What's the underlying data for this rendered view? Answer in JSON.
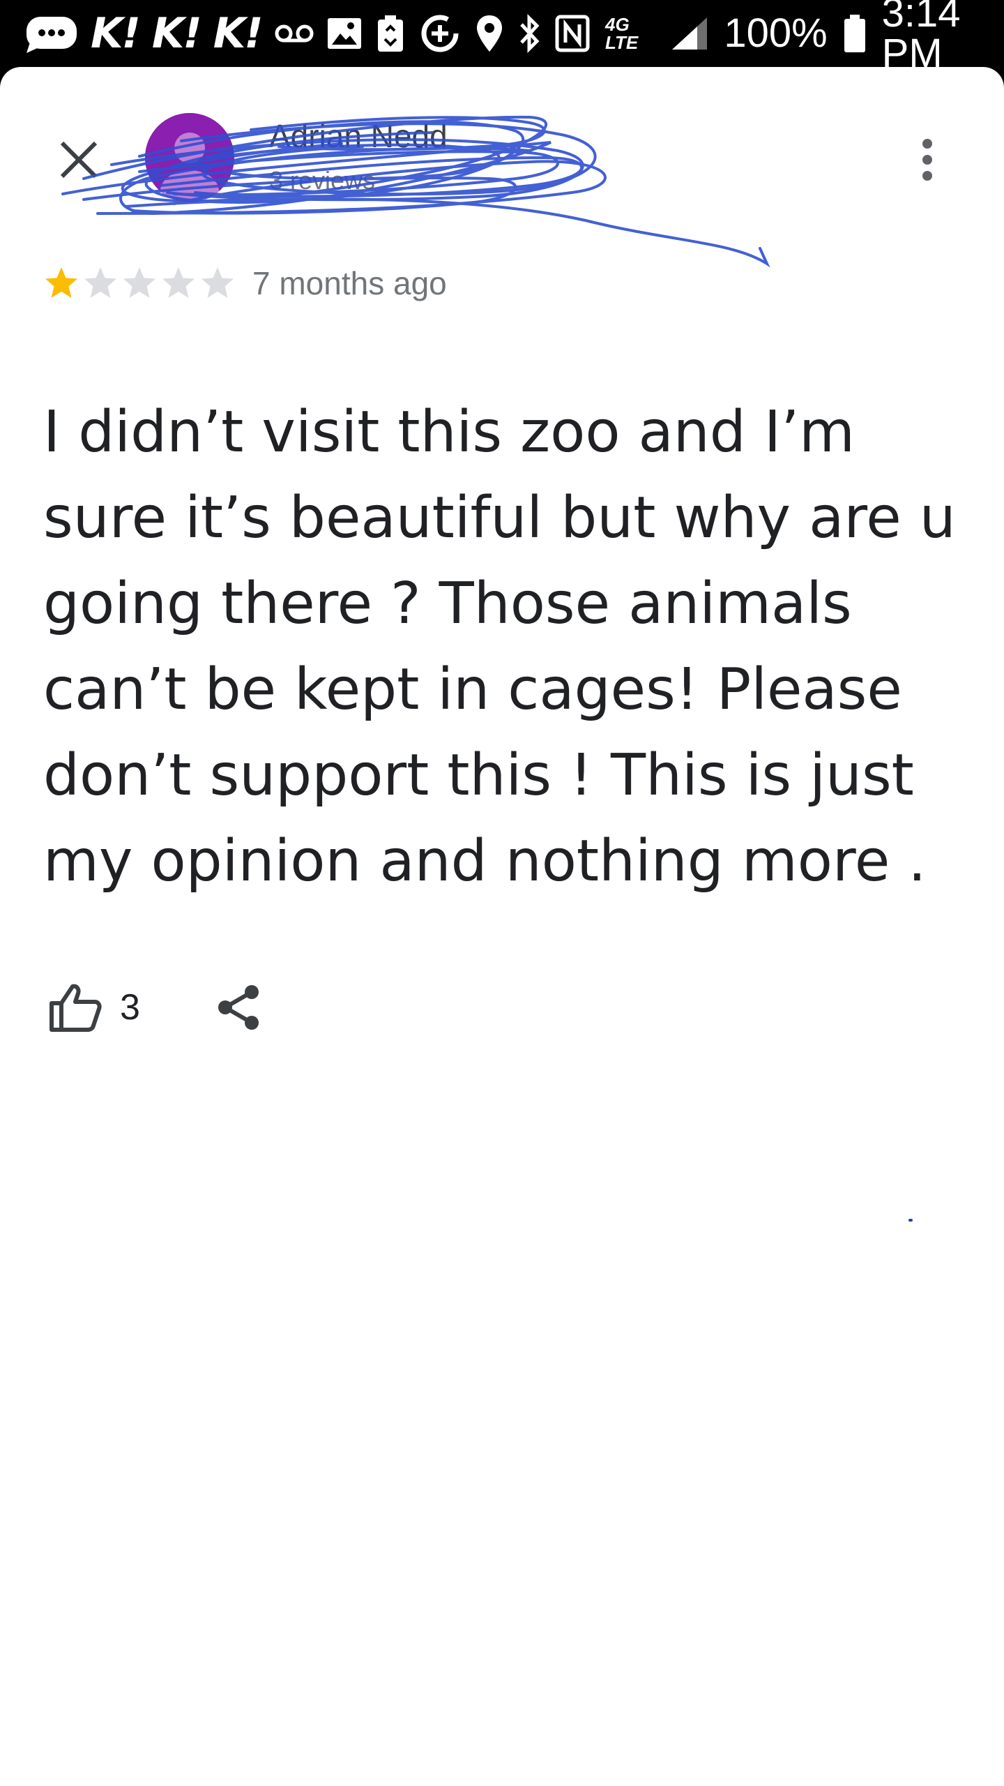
{
  "status_bar": {
    "kik_labels": [
      "K!",
      "K!",
      "K!"
    ],
    "network_label": "4G LTE",
    "battery_percent": "100%",
    "time": "3:14 PM",
    "icons": [
      "message-bubble-icon",
      "kik-icon",
      "voicemail-icon",
      "gallery-icon",
      "battery-saver-icon",
      "data-saver-icon",
      "location-icon",
      "bluetooth-icon",
      "nfc-icon",
      "network-4g-lte-icon",
      "signal-icon",
      "battery-icon"
    ]
  },
  "header": {
    "reviewer_name": "Adrian Nedd",
    "reviewer_meta": "3 reviews",
    "close_icon": "close-icon",
    "menu_icon": "more-vert-icon",
    "avatar_color": "#8a1fb0",
    "scribble_color": "#2f4fd0"
  },
  "review": {
    "rating": 1,
    "max_rating": 5,
    "star_filled_color": "#fbbc04",
    "star_empty_color": "#dadce0",
    "time_ago": "7 months ago",
    "text": "I didn’t visit this zoo and I’m sure it’s beautiful but why are u going there ? Those animals can’t be kept in cages! Please don’t support this ! This is just my opinion and nothing more ."
  },
  "actions": {
    "like_count": "3",
    "like_icon": "thumb-up-icon",
    "share_icon": "share-icon"
  }
}
